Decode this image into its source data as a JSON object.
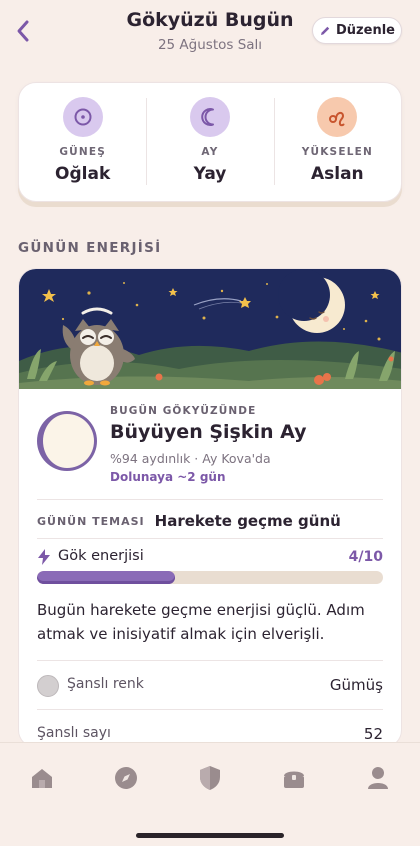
{
  "header": {
    "title": "Gökyüzü Bugün",
    "date": "25 Ağustos Salı",
    "edit_label": "Düzenle"
  },
  "signs": [
    {
      "label": "GÜNEŞ",
      "value": "Oğlak",
      "icon": "sun-icon",
      "color": "#d9c9ee"
    },
    {
      "label": "AY",
      "value": "Yay",
      "icon": "crescent-moon-icon",
      "color": "#d9c9ee"
    },
    {
      "label": "YÜKSELEN",
      "value": "Aslan",
      "icon": "leo-icon",
      "color": "#f7c9ad"
    }
  ],
  "section": {
    "title": "GÜNÜN ENERJİSİ"
  },
  "moon": {
    "kicker": "BUGÜN GÖKYÜZÜNDE",
    "phase": "Büyüyen Şişkin Ay",
    "detail": "%94 aydınlık · Ay Kova'da",
    "full_moon": "Dolunaya ~2 gün"
  },
  "theme": {
    "label": "GÜNÜN TEMASI",
    "value": "Harekete geçme günü"
  },
  "energy": {
    "label": "Gök enerjisi",
    "value_text": "4/10",
    "level": 0.4
  },
  "description": "Bugün harekete geçme enerjisi güçlü. Adım atmak ve inisiyatif almak için elverişli.",
  "lucky": {
    "color_label": "Şanslı renk",
    "color_value": "Gümüş",
    "number_label": "Şanslı sayı",
    "number_value": "52"
  },
  "nav": [
    "home-icon",
    "compass-icon",
    "shield-icon",
    "chest-icon",
    "profile-icon"
  ],
  "colors": {
    "accent": "#7c58a8",
    "background": "#f8eee9",
    "night_sky": "#1f2a5c"
  }
}
